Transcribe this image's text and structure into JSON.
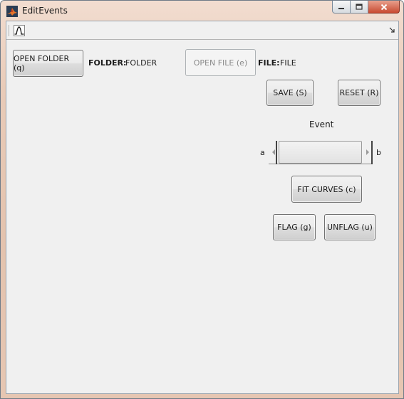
{
  "window": {
    "title": "EditEvents",
    "app_icon": "matlab-icon",
    "caption": {
      "minimize_icon": "minimize-icon",
      "maximize_icon": "maximize-icon",
      "close_icon": "close-icon"
    }
  },
  "toolbar": {
    "tool_icon": "curve-plot-icon",
    "expand_icon": "toolbar-expand-icon"
  },
  "controls": {
    "open_folder": "OPEN FOLDER (q)",
    "folder_label": "FOLDER:",
    "folder_value": "FOLDER",
    "open_file": "OPEN FILE (e)",
    "file_label": "FILE:",
    "file_value": "FILE",
    "save": "SAVE (S)",
    "reset": "RESET (R)",
    "event_label": "Event",
    "slider_min_label": "a",
    "slider_max_label": "b",
    "slider_value": 0,
    "fit_curves": "FIT CURVES (c)",
    "flag": "FLAG (g)",
    "unflag": "UNFLAG (u)"
  },
  "colors": {
    "frame": "#e6c6b2",
    "client_bg": "#f0f0f0",
    "close_button": "#c84a31"
  }
}
